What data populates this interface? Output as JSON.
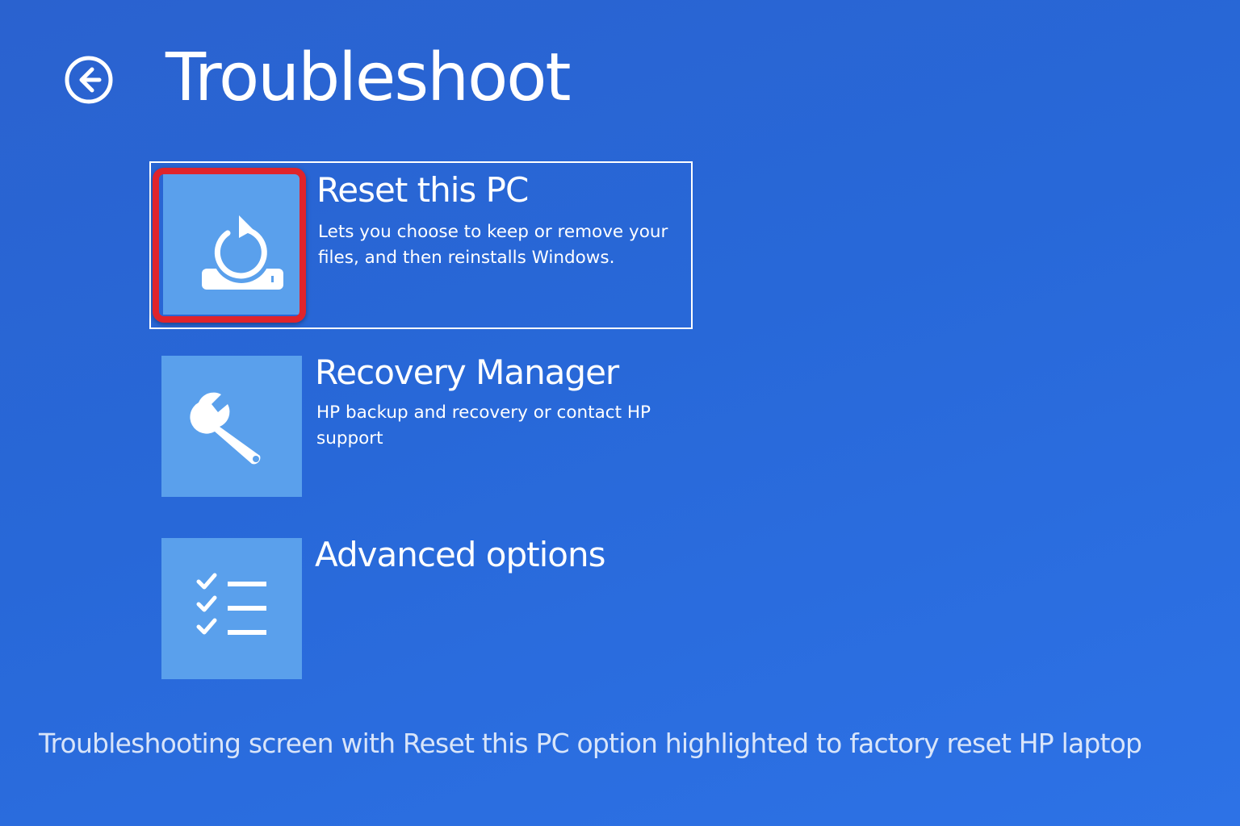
{
  "header": {
    "title": "Troubleshoot",
    "back_icon": "back-arrow-circle-icon"
  },
  "options": [
    {
      "title": "Reset this PC",
      "description": "Lets you choose to keep or remove your files, and then reinstalls Windows.",
      "icon": "reset-pc-icon",
      "selected": true,
      "highlighted": true
    },
    {
      "title": "Recovery Manager",
      "description": "HP backup and recovery or contact HP support",
      "icon": "wrench-icon",
      "selected": false
    },
    {
      "title": "Advanced options",
      "description": "",
      "icon": "checklist-icon",
      "selected": false
    }
  ],
  "caption": "Troubleshooting screen with Reset this PC option highlighted to factory reset HP laptop",
  "colors": {
    "background": "#2868d8",
    "tile": "#5aa0ec",
    "highlight": "#e0242b",
    "text": "#ffffff"
  }
}
